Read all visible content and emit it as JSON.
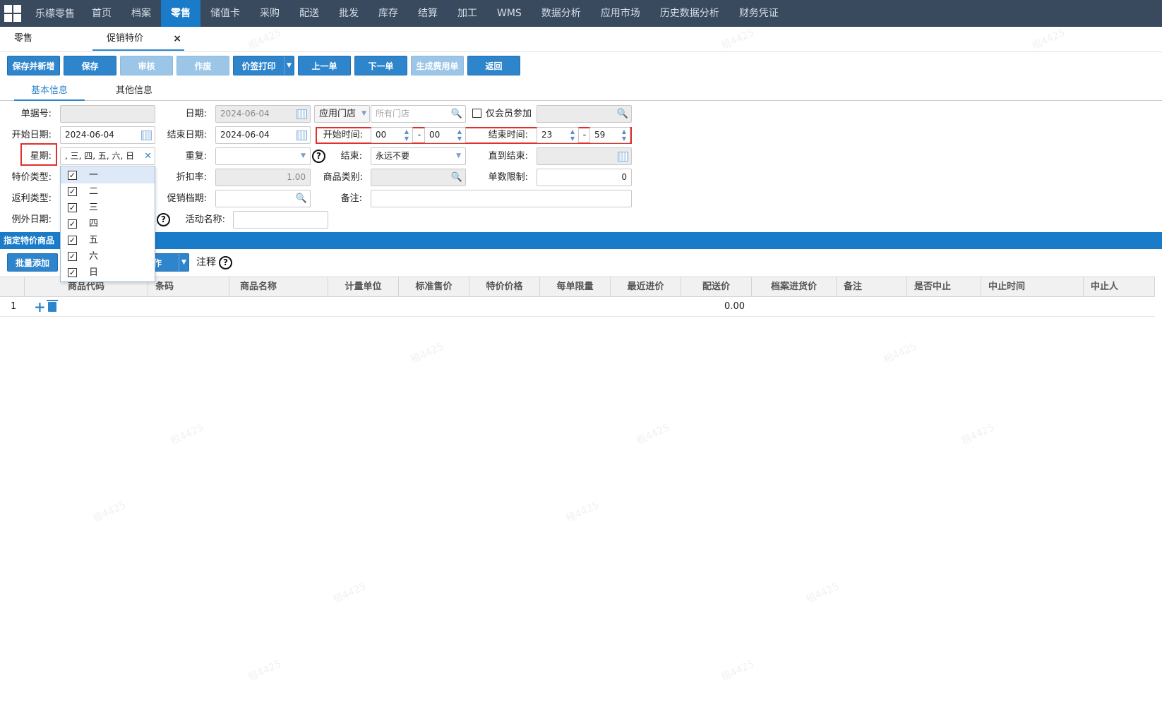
{
  "topnav": {
    "brand": "乐檬零售",
    "items": [
      "首页",
      "档案",
      "零售",
      "储值卡",
      "采购",
      "配送",
      "批发",
      "库存",
      "结算",
      "加工",
      "WMS",
      "数据分析",
      "应用市场",
      "历史数据分析",
      "财务凭证"
    ],
    "active": "零售"
  },
  "tabs": {
    "home": "零售",
    "current": "促销特价",
    "close": "×"
  },
  "toolbar": {
    "save_new": "保存并新增",
    "save": "保存",
    "audit": "审核",
    "void": "作废",
    "print": "价签打印",
    "prev": "上一单",
    "next": "下一单",
    "gen_fee": "生成费用单",
    "back": "返回"
  },
  "subtabs": {
    "basic": "基本信息",
    "other": "其他信息"
  },
  "form": {
    "doc_no_label": "单据号:",
    "doc_no": "",
    "date_label": "日期:",
    "date": "2024-06-04",
    "store_scope": "应用门店",
    "store_placeholder": "所有门店",
    "member_only": "仅会员参加",
    "start_date_label": "开始日期:",
    "start_date": "2024-06-04",
    "end_date_label": "结束日期:",
    "end_date": "2024-06-04",
    "start_time_label": "开始时间:",
    "start_hour": "00",
    "start_min": "00",
    "end_time_label": "结束时间:",
    "end_hour": "23",
    "end_min": "59",
    "time_sep": "-",
    "week_label": "星期:",
    "week_value": ", 三, 四, 五, 六, 日",
    "repeat_label": "重复:",
    "end_label": "结束:",
    "end_value": "永远不要",
    "until_end_label": "直到结束:",
    "special_type_label": "特价类型:",
    "discount_label": "折扣率:",
    "discount": "1.00",
    "category_label": "商品类别:",
    "limit_label": "单数限制:",
    "limit": "0",
    "rebate_label": "返利类型:",
    "promo_level_label": "促销档期:",
    "remark_label": "备注:",
    "exception_label": "例外日期:",
    "activity_label": "活动名称:"
  },
  "week_dropdown": [
    "一",
    "二",
    "三",
    "四",
    "五",
    "六",
    "日"
  ],
  "section": {
    "title": "指定特价商品",
    "batch_add": "批量添加",
    "op_fragment": "作",
    "note": "注释"
  },
  "table": {
    "columns": [
      "商品代码",
      "条码",
      "商品名称",
      "计量单位",
      "标准售价",
      "特价价格",
      "每单限量",
      "最近进价",
      "配送价",
      "档案进货价",
      "备注",
      "是否中止",
      "中止时间",
      "中止人"
    ],
    "rows": [
      {
        "index": "1",
        "delivery_price": "0.00"
      }
    ]
  },
  "watermark": "租4425",
  "colors": {
    "nav_bg": "#394a5e",
    "accent": "#1a7bc9",
    "button": "#2e85cc",
    "highlight_border": "#e0302d"
  }
}
